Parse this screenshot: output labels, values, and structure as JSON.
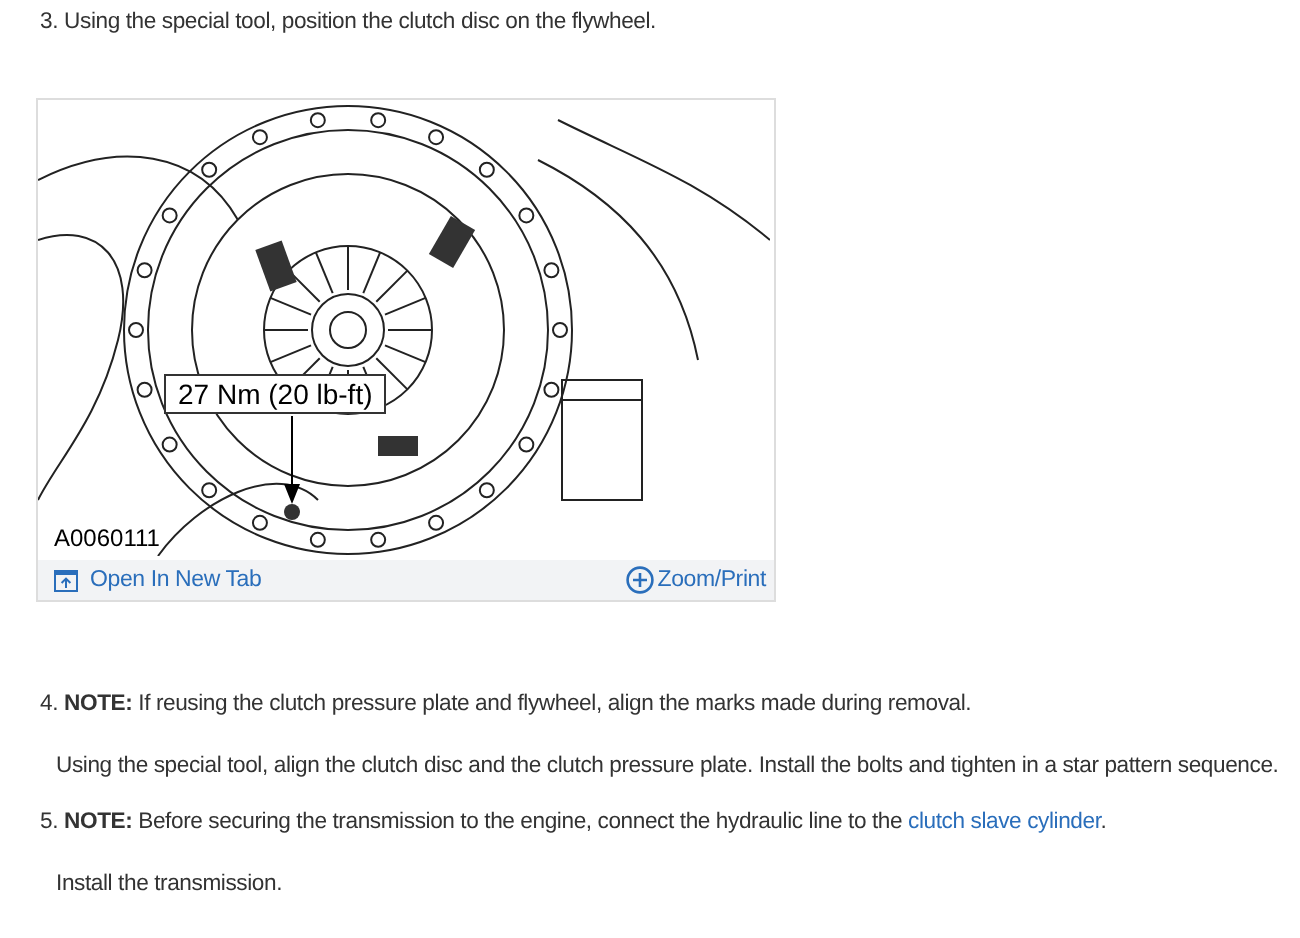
{
  "intro_step": {
    "number": "3.",
    "text": "Using the special tool, position the clutch disc on the flywheel."
  },
  "figure": {
    "callout": "27 Nm (20 lb-ft)",
    "figure_id": "A0060111",
    "open_link": "Open In New Tab",
    "zoom_link": "Zoom/Print"
  },
  "steps": [
    {
      "number": "4.",
      "note": "**NOTE:** If reusing the clutch pressure plate and flywheel, align the marks made during removal.",
      "detail": "Using the special tool, align the clutch disc and the clutch pressure plate. Install the bolts and tighten in a star pattern sequence."
    },
    {
      "number": "5.",
      "note": "**NOTE:** Before securing the transmission to the engine, connect the hydraulic line to the ",
      "link": "clutch slave cylinder",
      "note_end": ".",
      "detail": "Install the transmission."
    }
  ]
}
